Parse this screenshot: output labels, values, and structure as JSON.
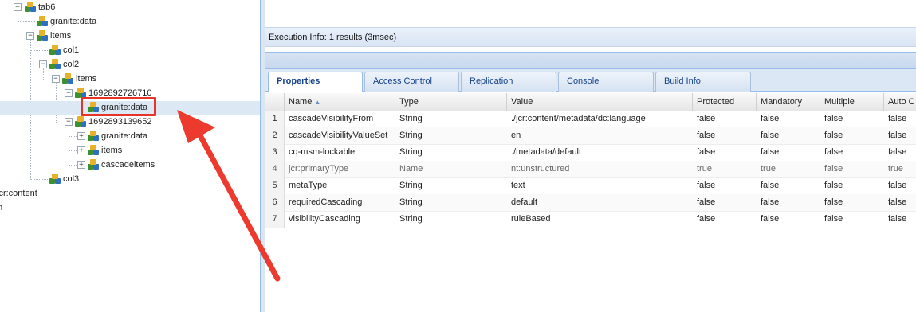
{
  "tree": {
    "nodes": [
      {
        "label": "tab6",
        "toggle": "−"
      },
      {
        "label": "granite:data",
        "toggle": ""
      },
      {
        "label": "items",
        "toggle": "−"
      },
      {
        "label": "col1",
        "toggle": ""
      },
      {
        "label": "col2",
        "toggle": "−"
      },
      {
        "label": "items",
        "toggle": "−"
      },
      {
        "label": "1692892726710",
        "toggle": "−"
      },
      {
        "label": "granite:data",
        "toggle": ""
      },
      {
        "label": "1692893139652",
        "toggle": "−"
      },
      {
        "label": "granite:data",
        "toggle": "+"
      },
      {
        "label": "items",
        "toggle": "+"
      },
      {
        "label": "cascadeitems",
        "toggle": "+"
      },
      {
        "label": "col3",
        "toggle": ""
      },
      {
        "label": "jcr:content",
        "toggle": ""
      },
      {
        "label": "m",
        "toggle": ""
      }
    ]
  },
  "exec_info": "Execution Info: 1 results (3msec)",
  "tabs": [
    "Properties",
    "Access Control",
    "Replication",
    "Console",
    "Build Info"
  ],
  "grid": {
    "columns": [
      "Name",
      "Type",
      "Value",
      "Protected",
      "Mandatory",
      "Multiple",
      "Auto C"
    ],
    "rows": [
      {
        "n": "1",
        "name": "cascadeVisibilityFrom",
        "type": "String",
        "value": "./jcr:content/metadata/dc:language",
        "protected": "false",
        "mandatory": "false",
        "multiple": "false",
        "auto": "false"
      },
      {
        "n": "2",
        "name": "cascadeVisibilityValueSet",
        "type": "String",
        "value": "en",
        "protected": "false",
        "mandatory": "false",
        "multiple": "false",
        "auto": "false"
      },
      {
        "n": "3",
        "name": "cq-msm-lockable",
        "type": "String",
        "value": "./metadata/default",
        "protected": "false",
        "mandatory": "false",
        "multiple": "false",
        "auto": "false"
      },
      {
        "n": "4",
        "name": "jcr:primaryType",
        "type": "Name",
        "value": "nt:unstructured",
        "protected": "true",
        "mandatory": "true",
        "multiple": "false",
        "auto": "true"
      },
      {
        "n": "5",
        "name": "metaType",
        "type": "String",
        "value": "text",
        "protected": "false",
        "mandatory": "false",
        "multiple": "false",
        "auto": "false"
      },
      {
        "n": "6",
        "name": "requiredCascading",
        "type": "String",
        "value": "default",
        "protected": "false",
        "mandatory": "false",
        "multiple": "false",
        "auto": "false"
      },
      {
        "n": "7",
        "name": "visibilityCascading",
        "type": "String",
        "value": "ruleBased",
        "protected": "false",
        "mandatory": "false",
        "multiple": "false",
        "auto": "false"
      }
    ]
  },
  "colors": {
    "highlight": "#e8332a",
    "tab_text": "#15428b",
    "selected_row": "#dde8f5"
  }
}
